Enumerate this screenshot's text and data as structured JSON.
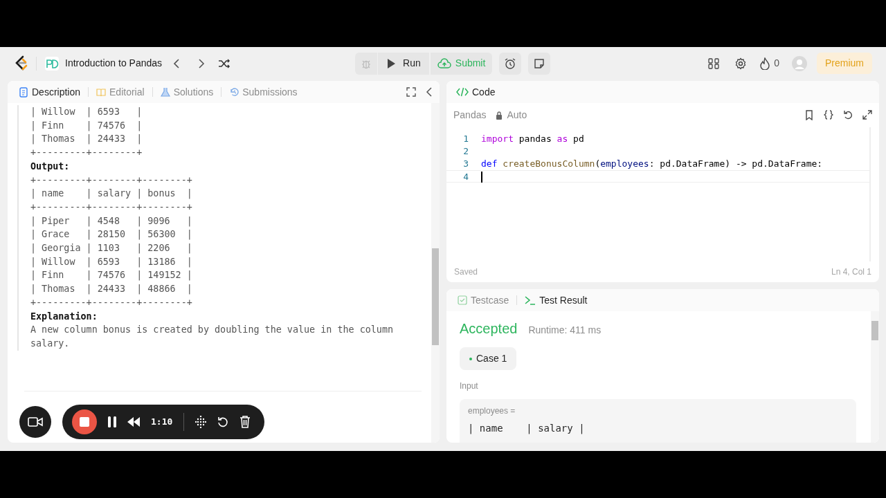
{
  "toolbar": {
    "title": "Introduction to Pandas",
    "run": "Run",
    "submit": "Submit",
    "streak": "0",
    "premium": "Premium"
  },
  "left_tabs": [
    {
      "label": "Description",
      "selected": true
    },
    {
      "label": "Editorial",
      "selected": false
    },
    {
      "label": "Solutions",
      "selected": false
    },
    {
      "label": "Submissions",
      "selected": false
    }
  ],
  "description": {
    "input_tail": [
      "| Willow  | 6593   |",
      "| Finn    | 74576  |",
      "| Thomas  | 24433  |",
      "+---------+--------+"
    ],
    "output_label": "Output:",
    "output_table": [
      "+---------+--------+--------+",
      "| name    | salary | bonus  |",
      "+---------+--------+--------+",
      "| Piper   | 4548   | 9096   |",
      "| Grace   | 28150  | 56300  |",
      "| Georgia | 1103   | 2206   |",
      "| Willow  | 6593   | 13186  |",
      "| Finn    | 74576  | 149152 |",
      "| Thomas  | 24433  | 48866  |",
      "+---------+--------+--------+"
    ],
    "explanation_label": "Explanation:",
    "explanation": "A new column bonus is created by doubling the value in the column salary."
  },
  "code": {
    "tab": "Code",
    "language": "Pandas",
    "mode": "Auto",
    "lines": [
      {
        "number": "1",
        "current": false,
        "tokens": [
          {
            "text": "import",
            "kind": "keyword"
          },
          {
            "text": " pandas ",
            "kind": "plain"
          },
          {
            "text": "as",
            "kind": "keyword"
          },
          {
            "text": " pd",
            "kind": "plain"
          }
        ]
      },
      {
        "number": "2",
        "current": false
      },
      {
        "number": "3",
        "current": false,
        "tokens": [
          {
            "text": "def",
            "kind": "def"
          },
          {
            "text": " createBonusColumn",
            "kind": "function"
          },
          {
            "text": "(",
            "kind": "plain"
          },
          {
            "text": "employees",
            "kind": "param"
          },
          {
            "text": ": pd.DataFrame) -> pd.DataFrame:",
            "kind": "plain"
          }
        ]
      },
      {
        "number": "4",
        "current": true
      }
    ],
    "status": "Saved",
    "position": "Ln 4, Col 1"
  },
  "result": {
    "tabs": [
      {
        "label": "Testcase",
        "selected": false
      },
      {
        "label": "Test Result",
        "selected": true
      }
    ],
    "verdict": "Accepted",
    "runtime": "Runtime: 411 ms",
    "cases": [
      {
        "label": "Case 1",
        "selected": true,
        "passed": true
      }
    ],
    "input_label": "Input",
    "param": "employees =",
    "value": "| name    | salary |"
  },
  "recorder": {
    "time": "1:10"
  }
}
